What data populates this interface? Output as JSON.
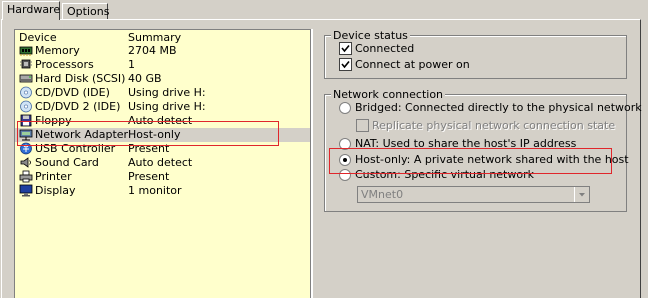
{
  "tabs": [
    {
      "label": "Hardware",
      "active": true
    },
    {
      "label": "Options",
      "active": false
    }
  ],
  "device_list": {
    "columns": {
      "device": "Device",
      "summary": "Summary"
    },
    "rows": [
      {
        "icon": "memory-icon",
        "device": "Memory",
        "summary": "2704 MB"
      },
      {
        "icon": "processor-icon",
        "device": "Processors",
        "summary": "1"
      },
      {
        "icon": "hard-disk-icon",
        "device": "Hard Disk (SCSI)",
        "summary": "40 GB"
      },
      {
        "icon": "cd-dvd-icon",
        "device": "CD/DVD (IDE)",
        "summary": "Using drive H:"
      },
      {
        "icon": "cd-dvd-icon",
        "device": "CD/DVD 2 (IDE)",
        "summary": "Using drive H:"
      },
      {
        "icon": "floppy-icon",
        "device": "Floppy",
        "summary": "Auto detect"
      },
      {
        "icon": "network-adapter-icon",
        "device": "Network Adapter",
        "summary": "Host-only",
        "selected": true
      },
      {
        "icon": "usb-controller-icon",
        "device": "USB Controller",
        "summary": "Present"
      },
      {
        "icon": "sound-card-icon",
        "device": "Sound Card",
        "summary": "Auto detect"
      },
      {
        "icon": "printer-icon",
        "device": "Printer",
        "summary": "Present"
      },
      {
        "icon": "display-icon",
        "device": "Display",
        "summary": "1 monitor"
      }
    ]
  },
  "device_status": {
    "title": "Device status",
    "connected_label": "Connected",
    "connected_checked": true,
    "connect_power_label": "Connect at power on",
    "connect_power_checked": true
  },
  "network_connection": {
    "title": "Network connection",
    "bridged_label": "Bridged: Connected directly to the physical network",
    "replicate_label": "Replicate physical network connection state",
    "nat_label": "NAT: Used to share the host's IP address",
    "hostonly_label": "Host-only: A private network shared with the host",
    "custom_label": "Custom: Specific virtual network",
    "selected": "hostonly",
    "custom_select_value": "VMnet0"
  },
  "colors": {
    "list_background": "#ffffcc",
    "highlight_box": "#e0262b",
    "dialog_face": "#d4d0c8"
  }
}
